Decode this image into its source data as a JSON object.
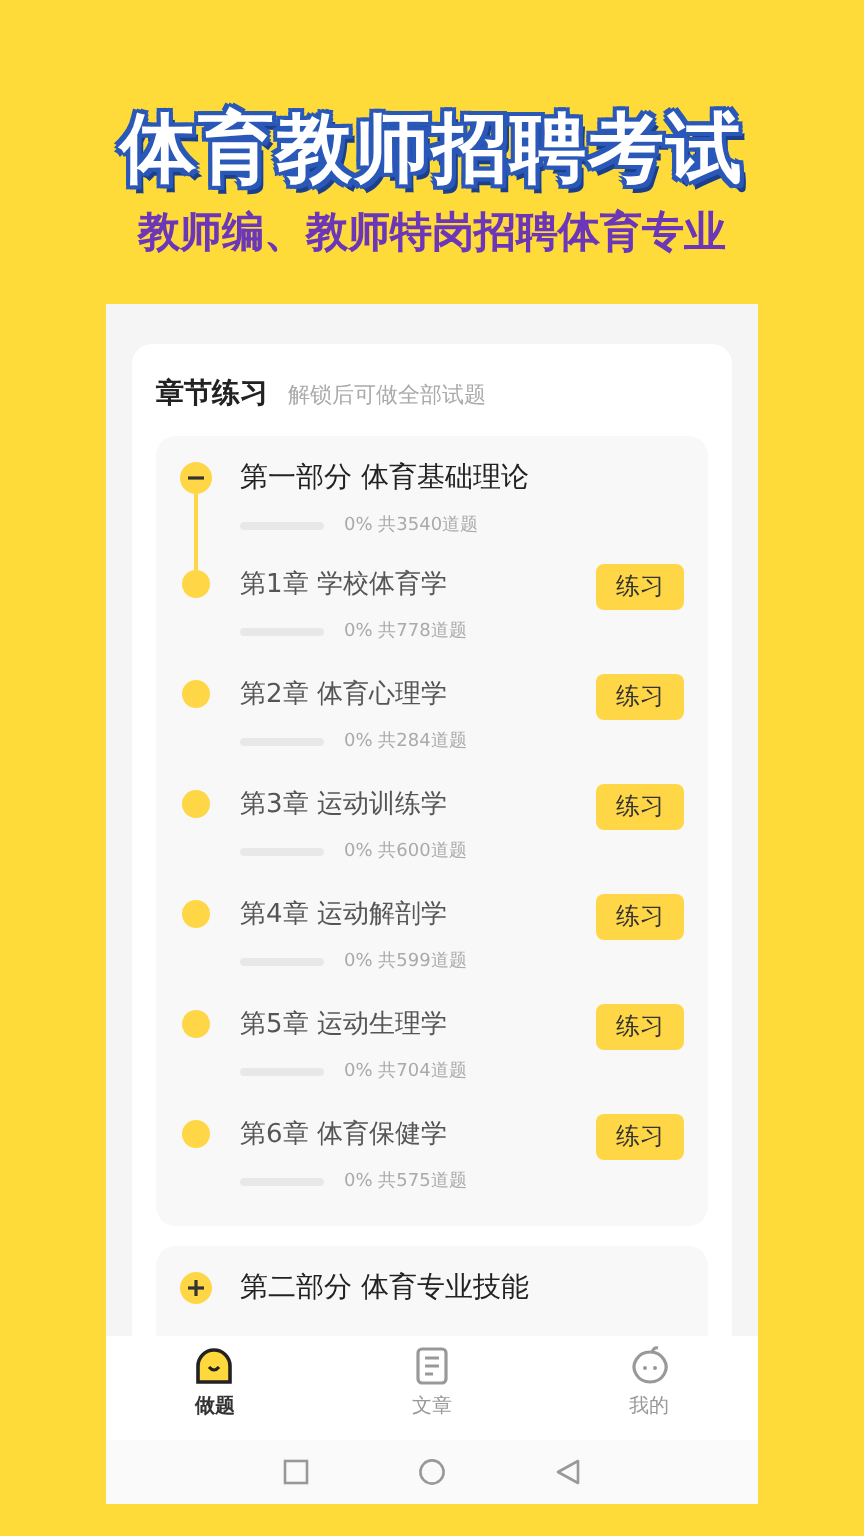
{
  "banner": {
    "title": "体育教师招聘考试",
    "subtitle": "教师编、教师特岗招聘体育专业"
  },
  "section": {
    "title": "章节练习",
    "hint": "解锁后可做全部试题"
  },
  "parts": [
    {
      "title": "第一部分 体育基础理论",
      "expanded": true,
      "level": 0,
      "reading": "0% 共3540道题",
      "chapters": [
        {
          "title": "第1章 学校体育学",
          "level": 0,
          "reading": "0% 共778道题",
          "button": "练习"
        },
        {
          "title": "第2章 体育心理学",
          "level": 0,
          "reading": "0% 共284道题",
          "button": "练习"
        },
        {
          "title": "第3章 运动训练学",
          "level": 0,
          "reading": "0% 共600道题",
          "button": "练习"
        },
        {
          "title": "第4章 运动解剖学",
          "level": 0,
          "reading": "0% 共599道题",
          "button": "练习"
        },
        {
          "title": "第5章 运动生理学",
          "level": 0,
          "reading": "0% 共704道题",
          "button": "练习"
        },
        {
          "title": "第6章 体育保健学",
          "level": 0,
          "reading": "0% 共575道题",
          "button": "练习"
        }
      ]
    },
    {
      "title": "第二部分 体育专业技能",
      "expanded": false
    }
  ],
  "tabs": [
    {
      "label": "做题",
      "selected": true
    },
    {
      "label": "文章",
      "selected": false
    },
    {
      "label": "我的",
      "selected": false
    }
  ]
}
